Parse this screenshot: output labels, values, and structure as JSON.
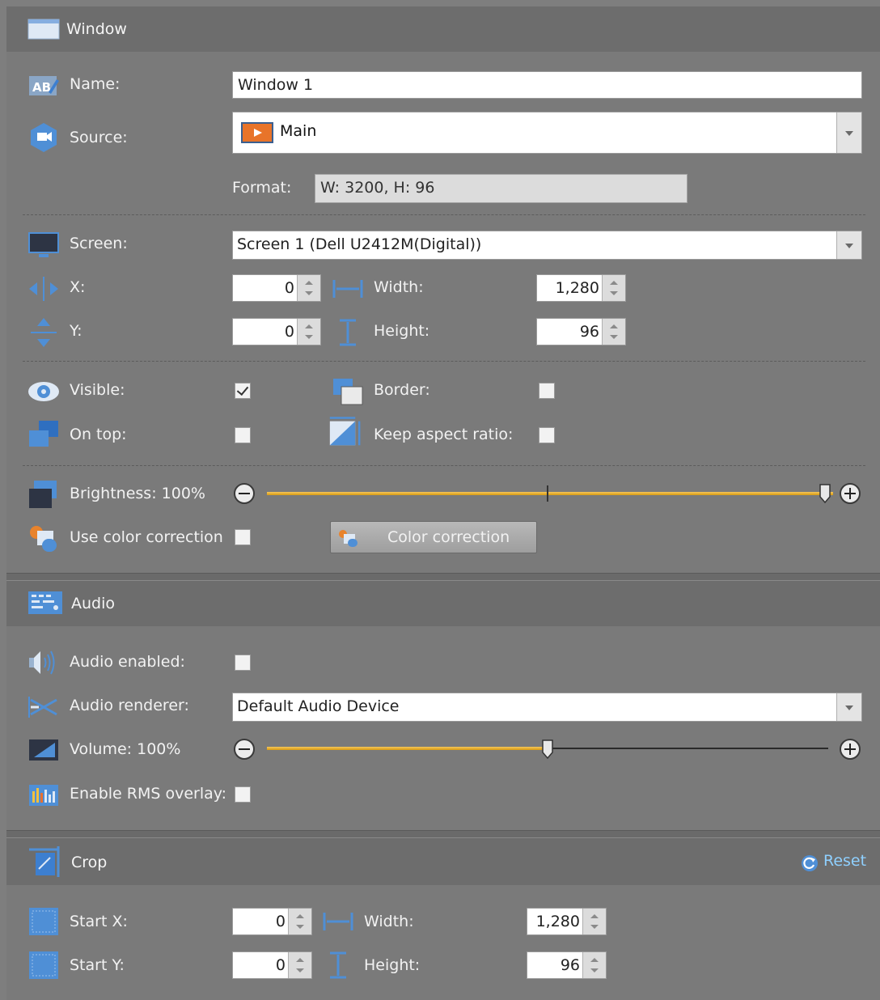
{
  "window_section": {
    "title": "Window",
    "name_label": "Name:",
    "name_value": "Window 1",
    "source_label": "Source:",
    "source_value": "Main",
    "format_label": "Format:",
    "format_value": "W: 3200, H: 96",
    "screen_label": "Screen:",
    "screen_value": "Screen 1 (Dell U2412M(Digital))",
    "x_label": "X:",
    "x_value": "0",
    "y_label": "Y:",
    "y_value": "0",
    "width_label": "Width:",
    "width_value": "1,280",
    "height_label": "Height:",
    "height_value": "96",
    "visible_label": "Visible:",
    "visible_checked": true,
    "border_label": "Border:",
    "border_checked": false,
    "ontop_label": "On top:",
    "ontop_checked": false,
    "aspect_label": "Keep aspect ratio:",
    "aspect_checked": false,
    "brightness_label": "Brightness: 100%",
    "brightness_level": 1.0,
    "color_corr_label": "Use color correction",
    "color_corr_checked": false,
    "color_corr_button": "Color correction"
  },
  "audio_section": {
    "title": "Audio",
    "enabled_label": "Audio enabled:",
    "enabled_checked": false,
    "renderer_label": "Audio renderer:",
    "renderer_value": "Default Audio Device",
    "volume_label": "Volume: 100%",
    "volume_level": 0.5,
    "rms_label": "Enable RMS overlay:",
    "rms_checked": false
  },
  "crop_section": {
    "title": "Crop",
    "reset_label": "Reset",
    "startx_label": "Start X:",
    "startx_value": "0",
    "starty_label": "Start Y:",
    "starty_value": "0",
    "width_label": "Width:",
    "width_value": "1,280",
    "height_label": "Height:",
    "height_value": "96"
  },
  "colors": {
    "slider_accent": "#f0a818",
    "reset_link": "#8fd0ff",
    "icon_blue": "#4f8fd6"
  }
}
